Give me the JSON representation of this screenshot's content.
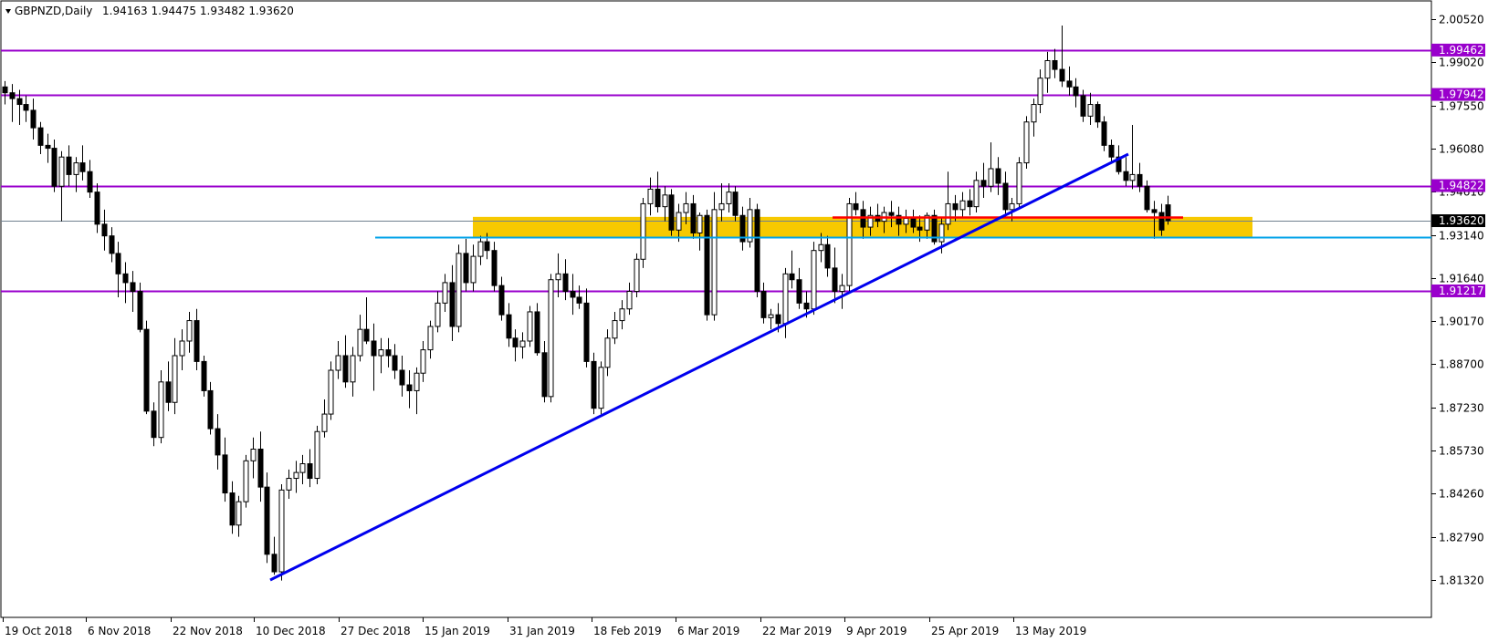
{
  "header": {
    "symbol_timeframe": "GBPNZD,Daily",
    "ohlc": "1.94163 1.94475 1.93482 1.93620"
  },
  "colors": {
    "background": "#ffffff",
    "candle": "#000000",
    "resistance_lines": "#9900cc",
    "trendline": "#0000ee",
    "zone_fill": "#f7c900",
    "zone_line": "#00a2e8",
    "red_line": "#ff0000",
    "current_price_line": "#708090"
  },
  "chart_data": {
    "type": "candlestick",
    "x_ticks": [
      "19 Oct 2018",
      "6 Nov 2018",
      "22 Nov 2018",
      "10 Dec 2018",
      "27 Dec 2018",
      "15 Jan 2019",
      "31 Jan 2019",
      "18 Feb 2019",
      "6 Mar 2019",
      "22 Mar 2019",
      "9 Apr 2019",
      "25 Apr 2019",
      "13 May 2019"
    ],
    "y_ticks": [
      "2.00520",
      "1.99020",
      "1.97550",
      "1.96080",
      "1.94610",
      "1.93140",
      "1.91640",
      "1.90170",
      "1.88700",
      "1.87230",
      "1.85730",
      "1.84260",
      "1.82790",
      "1.81320"
    ],
    "ylim": [
      1.8086,
      2.0122
    ],
    "horizontal_levels": [
      {
        "label": "1.99462",
        "value": 1.99462
      },
      {
        "label": "1.97942",
        "value": 1.97942
      },
      {
        "label": "1.94822",
        "value": 1.94822
      },
      {
        "label": "1.91217",
        "value": 1.91217
      }
    ],
    "current_price": {
      "label": "1.93620",
      "value": 1.9362
    },
    "zone": {
      "top": 1.9375,
      "bottom": 1.9305,
      "line": 1.9305
    },
    "red_level": 1.9375,
    "trendline": {
      "from": {
        "bar": 0,
        "date": "10 Dec 2018",
        "price": 1.8132
      },
      "to": {
        "date": "end of May 2019",
        "price": 1.959
      }
    },
    "candles": [
      [
        1.982,
        1.984,
        1.976,
        1.98
      ],
      [
        1.98,
        1.983,
        1.97,
        1.978
      ],
      [
        1.978,
        1.981,
        1.969,
        1.976
      ],
      [
        1.976,
        1.979,
        1.97,
        1.974
      ],
      [
        1.974,
        1.978,
        1.964,
        1.968
      ],
      [
        1.968,
        1.97,
        1.959,
        1.962
      ],
      [
        1.962,
        1.966,
        1.956,
        1.961
      ],
      [
        1.961,
        1.964,
        1.946,
        1.948
      ],
      [
        1.948,
        1.96,
        1.936,
        1.958
      ],
      [
        1.958,
        1.962,
        1.948,
        1.952
      ],
      [
        1.952,
        1.958,
        1.946,
        1.956
      ],
      [
        1.956,
        1.962,
        1.95,
        1.953
      ],
      [
        1.953,
        1.957,
        1.944,
        1.946
      ],
      [
        1.946,
        1.949,
        1.932,
        1.935
      ],
      [
        1.935,
        1.94,
        1.926,
        1.931
      ],
      [
        1.931,
        1.934,
        1.922,
        1.925
      ],
      [
        1.925,
        1.929,
        1.91,
        1.918
      ],
      [
        1.918,
        1.922,
        1.908,
        1.915
      ],
      [
        1.915,
        1.919,
        1.905,
        1.912
      ],
      [
        1.912,
        1.915,
        1.898,
        1.899
      ],
      [
        1.899,
        1.902,
        1.87,
        1.871
      ],
      [
        1.871,
        1.874,
        1.859,
        1.862
      ],
      [
        1.862,
        1.885,
        1.86,
        1.881
      ],
      [
        1.881,
        1.888,
        1.871,
        1.874
      ],
      [
        1.874,
        1.896,
        1.87,
        1.89
      ],
      [
        1.89,
        1.899,
        1.885,
        1.895
      ],
      [
        1.895,
        1.905,
        1.891,
        1.902
      ],
      [
        1.902,
        1.906,
        1.885,
        1.888
      ],
      [
        1.888,
        1.89,
        1.876,
        1.878
      ],
      [
        1.878,
        1.881,
        1.863,
        1.865
      ],
      [
        1.865,
        1.87,
        1.851,
        1.856
      ],
      [
        1.856,
        1.862,
        1.84,
        1.843
      ],
      [
        1.843,
        1.847,
        1.829,
        1.832
      ],
      [
        1.832,
        1.842,
        1.828,
        1.84
      ],
      [
        1.84,
        1.856,
        1.838,
        1.854
      ],
      [
        1.854,
        1.862,
        1.848,
        1.858
      ],
      [
        1.858,
        1.864,
        1.84,
        1.845
      ],
      [
        1.845,
        1.85,
        1.819,
        1.822
      ],
      [
        1.822,
        1.828,
        1.815,
        1.816
      ],
      [
        1.816,
        1.846,
        1.813,
        1.844
      ],
      [
        1.844,
        1.851,
        1.841,
        1.848
      ],
      [
        1.848,
        1.854,
        1.843,
        1.85
      ],
      [
        1.85,
        1.856,
        1.846,
        1.853
      ],
      [
        1.853,
        1.858,
        1.845,
        1.848
      ],
      [
        1.848,
        1.866,
        1.846,
        1.864
      ],
      [
        1.864,
        1.875,
        1.862,
        1.87
      ],
      [
        1.87,
        1.888,
        1.868,
        1.885
      ],
      [
        1.885,
        1.895,
        1.882,
        1.89
      ],
      [
        1.89,
        1.897,
        1.879,
        1.881
      ],
      [
        1.881,
        1.893,
        1.876,
        1.89
      ],
      [
        1.89,
        1.904,
        1.888,
        1.899
      ],
      [
        1.899,
        1.91,
        1.894,
        1.895
      ],
      [
        1.895,
        1.901,
        1.878,
        1.89
      ],
      [
        1.89,
        1.896,
        1.884,
        1.892
      ],
      [
        1.892,
        1.896,
        1.886,
        1.89
      ],
      [
        1.89,
        1.894,
        1.882,
        1.885
      ],
      [
        1.885,
        1.89,
        1.876,
        1.88
      ],
      [
        1.88,
        1.885,
        1.872,
        1.878
      ],
      [
        1.878,
        1.886,
        1.87,
        1.884
      ],
      [
        1.884,
        1.895,
        1.881,
        1.892
      ],
      [
        1.892,
        1.902,
        1.889,
        1.9
      ],
      [
        1.9,
        1.912,
        1.898,
        1.908
      ],
      [
        1.908,
        1.918,
        1.905,
        1.915
      ],
      [
        1.915,
        1.921,
        1.895,
        1.9
      ],
      [
        1.9,
        1.928,
        1.898,
        1.925
      ],
      [
        1.925,
        1.93,
        1.912,
        1.915
      ],
      [
        1.915,
        1.928,
        1.912,
        1.924
      ],
      [
        1.924,
        1.931,
        1.921,
        1.929
      ],
      [
        1.929,
        1.932,
        1.923,
        1.926
      ],
      [
        1.926,
        1.929,
        1.912,
        1.914
      ],
      [
        1.914,
        1.917,
        1.902,
        1.904
      ],
      [
        1.904,
        1.908,
        1.893,
        1.896
      ],
      [
        1.896,
        1.899,
        1.888,
        1.893
      ],
      [
        1.893,
        1.898,
        1.889,
        1.895
      ],
      [
        1.895,
        1.907,
        1.893,
        1.905
      ],
      [
        1.905,
        1.908,
        1.89,
        1.891
      ],
      [
        1.891,
        1.895,
        1.874,
        1.876
      ],
      [
        1.876,
        1.918,
        1.874,
        1.916
      ],
      [
        1.916,
        1.925,
        1.91,
        1.918
      ],
      [
        1.918,
        1.923,
        1.909,
        1.912
      ],
      [
        1.912,
        1.918,
        1.904,
        1.91
      ],
      [
        1.91,
        1.914,
        1.906,
        1.908
      ],
      [
        1.908,
        1.913,
        1.886,
        1.888
      ],
      [
        1.888,
        1.891,
        1.87,
        1.872
      ],
      [
        1.872,
        1.888,
        1.87,
        1.886
      ],
      [
        1.886,
        1.899,
        1.883,
        1.896
      ],
      [
        1.896,
        1.905,
        1.894,
        1.902
      ],
      [
        1.902,
        1.909,
        1.899,
        1.906
      ],
      [
        1.906,
        1.915,
        1.904,
        1.912
      ],
      [
        1.912,
        1.925,
        1.91,
        1.923
      ],
      [
        1.923,
        1.944,
        1.92,
        1.942
      ],
      [
        1.942,
        1.951,
        1.938,
        1.947
      ],
      [
        1.947,
        1.953,
        1.939,
        1.941
      ],
      [
        1.941,
        1.948,
        1.936,
        1.945
      ],
      [
        1.945,
        1.947,
        1.931,
        1.933
      ],
      [
        1.933,
        1.942,
        1.929,
        1.939
      ],
      [
        1.939,
        1.946,
        1.935,
        1.942
      ],
      [
        1.942,
        1.945,
        1.93,
        1.932
      ],
      [
        1.932,
        1.939,
        1.926,
        1.938
      ],
      [
        1.938,
        1.94,
        1.902,
        1.904
      ],
      [
        1.904,
        1.946,
        1.902,
        1.94
      ],
      [
        1.94,
        1.949,
        1.936,
        1.942
      ],
      [
        1.942,
        1.949,
        1.939,
        1.946
      ],
      [
        1.946,
        1.948,
        1.936,
        1.938
      ],
      [
        1.938,
        1.941,
        1.926,
        1.929
      ],
      [
        1.929,
        1.944,
        1.927,
        1.94
      ],
      [
        1.94,
        1.942,
        1.91,
        1.912
      ],
      [
        1.912,
        1.915,
        1.901,
        1.903
      ],
      [
        1.903,
        1.906,
        1.899,
        1.904
      ],
      [
        1.904,
        1.908,
        1.898,
        1.901
      ],
      [
        1.901,
        1.92,
        1.896,
        1.918
      ],
      [
        1.918,
        1.926,
        1.913,
        1.916
      ],
      [
        1.916,
        1.92,
        1.906,
        1.908
      ],
      [
        1.908,
        1.912,
        1.903,
        1.906
      ],
      [
        1.906,
        1.929,
        1.904,
        1.926
      ],
      [
        1.926,
        1.932,
        1.922,
        1.928
      ],
      [
        1.928,
        1.931,
        1.917,
        1.92
      ],
      [
        1.92,
        1.927,
        1.908,
        1.912
      ],
      [
        1.912,
        1.918,
        1.906,
        1.914
      ],
      [
        1.914,
        1.944,
        1.912,
        1.942
      ],
      [
        1.942,
        1.946,
        1.938,
        1.94
      ],
      [
        1.94,
        1.943,
        1.93,
        1.934
      ],
      [
        1.934,
        1.941,
        1.931,
        1.938
      ],
      [
        1.938,
        1.942,
        1.934,
        1.936
      ],
      [
        1.936,
        1.941,
        1.932,
        1.939
      ],
      [
        1.939,
        1.943,
        1.934,
        1.938
      ],
      [
        1.938,
        1.941,
        1.931,
        1.935
      ],
      [
        1.935,
        1.94,
        1.932,
        1.937
      ],
      [
        1.937,
        1.94,
        1.932,
        1.934
      ],
      [
        1.934,
        1.938,
        1.929,
        1.933
      ],
      [
        1.933,
        1.939,
        1.93,
        1.938
      ],
      [
        1.938,
        1.94,
        1.928,
        1.929
      ],
      [
        1.929,
        1.937,
        1.925,
        1.935
      ],
      [
        1.935,
        1.953,
        1.933,
        1.942
      ],
      [
        1.942,
        1.945,
        1.936,
        1.94
      ],
      [
        1.94,
        1.946,
        1.937,
        1.943
      ],
      [
        1.943,
        1.947,
        1.938,
        1.941
      ],
      [
        1.941,
        1.953,
        1.939,
        1.95
      ],
      [
        1.95,
        1.956,
        1.944,
        1.948
      ],
      [
        1.948,
        1.963,
        1.946,
        1.954
      ],
      [
        1.954,
        1.958,
        1.945,
        1.949
      ],
      [
        1.949,
        1.953,
        1.937,
        1.94
      ],
      [
        1.94,
        1.944,
        1.936,
        1.942
      ],
      [
        1.942,
        1.958,
        1.94,
        1.956
      ],
      [
        1.956,
        1.972,
        1.954,
        1.97
      ],
      [
        1.97,
        1.978,
        1.965,
        1.976
      ],
      [
        1.976,
        1.988,
        1.973,
        1.985
      ],
      [
        1.985,
        1.994,
        1.98,
        1.991
      ],
      [
        1.991,
        1.995,
        1.985,
        1.988
      ],
      [
        1.988,
        2.003,
        1.982,
        1.984
      ],
      [
        1.984,
        1.989,
        1.979,
        1.982
      ],
      [
        1.982,
        1.985,
        1.975,
        1.979
      ],
      [
        1.979,
        1.981,
        1.97,
        1.972
      ],
      [
        1.972,
        1.98,
        1.969,
        1.976
      ],
      [
        1.976,
        1.977,
        1.968,
        1.97
      ],
      [
        1.97,
        1.972,
        1.96,
        1.962
      ],
      [
        1.962,
        1.964,
        1.956,
        1.958
      ],
      [
        1.958,
        1.962,
        1.952,
        1.953
      ],
      [
        1.953,
        1.958,
        1.948,
        1.95
      ],
      [
        1.95,
        1.969,
        1.947,
        1.952
      ],
      [
        1.952,
        1.956,
        1.946,
        1.948
      ],
      [
        1.948,
        1.95,
        1.939,
        1.94
      ],
      [
        1.94,
        1.943,
        1.93,
        1.939
      ],
      [
        1.939,
        1.942,
        1.931,
        1.933
      ],
      [
        1.94163,
        1.94475,
        1.93482,
        1.9362
      ]
    ]
  }
}
